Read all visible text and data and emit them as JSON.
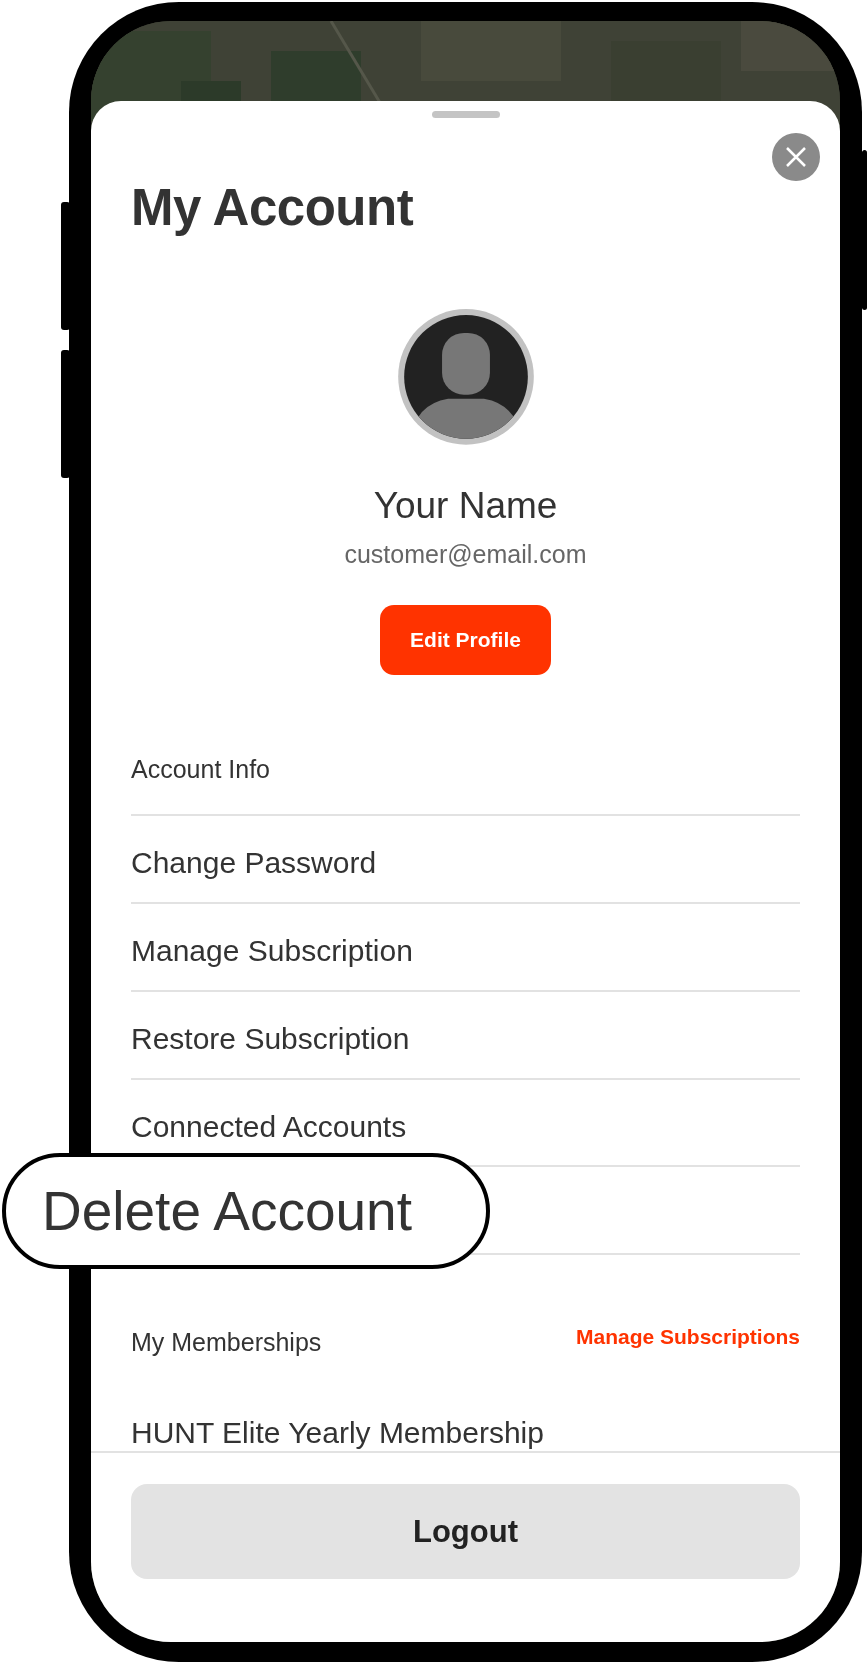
{
  "title": "My Account",
  "profile": {
    "name": "Your Name",
    "email": "customer@email.com",
    "edit_button": "Edit Profile"
  },
  "account_section": {
    "heading": "Account Info",
    "items": [
      "Change Password",
      "Manage Subscription",
      "Restore Subscription",
      "Connected Accounts"
    ]
  },
  "callout": "Delete Account",
  "memberships": {
    "heading": "My Memberships",
    "link": "Manage Subscriptions",
    "items": [
      "HUNT Elite Yearly Membership"
    ]
  },
  "logout_button": "Logout"
}
